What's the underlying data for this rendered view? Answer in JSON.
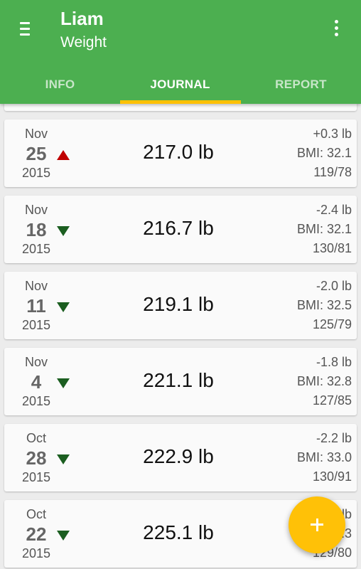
{
  "header": {
    "title": "Liam",
    "subtitle": "Weight",
    "menu_icon": "menu-icon",
    "more_icon": "more-vert-icon"
  },
  "tabs": [
    {
      "label": "INFO",
      "active": false
    },
    {
      "label": "JOURNAL",
      "active": true
    },
    {
      "label": "REPORT",
      "active": false
    }
  ],
  "entries": [
    {
      "month": "Nov",
      "day": "25",
      "year": "2015",
      "trend": "up",
      "weight": "217.0 lb",
      "delta": "+0.3 lb",
      "bmi": "BMI: 32.1",
      "bp": "119/78"
    },
    {
      "month": "Nov",
      "day": "18",
      "year": "2015",
      "trend": "down",
      "weight": "216.7 lb",
      "delta": "-2.4 lb",
      "bmi": "BMI: 32.1",
      "bp": "130/81"
    },
    {
      "month": "Nov",
      "day": "11",
      "year": "2015",
      "trend": "down",
      "weight": "219.1 lb",
      "delta": "-2.0 lb",
      "bmi": "BMI: 32.5",
      "bp": "125/79"
    },
    {
      "month": "Nov",
      "day": "4",
      "year": "2015",
      "trend": "down",
      "weight": "221.1 lb",
      "delta": "-1.8 lb",
      "bmi": "BMI: 32.8",
      "bp": "127/85"
    },
    {
      "month": "Oct",
      "day": "28",
      "year": "2015",
      "trend": "down",
      "weight": "222.9 lb",
      "delta": "-2.2 lb",
      "bmi": "BMI: 33.0",
      "bp": "130/91"
    },
    {
      "month": "Oct",
      "day": "22",
      "year": "2015",
      "trend": "down",
      "weight": "225.1 lb",
      "delta": "-2.3 lb",
      "bmi": "BMI: 33.3",
      "bp": "129/80"
    }
  ],
  "fab": {
    "icon": "add-icon"
  },
  "colors": {
    "primary": "#4caf50",
    "accent": "#ffc107",
    "up": "#c00000",
    "down": "#1b5e20"
  }
}
